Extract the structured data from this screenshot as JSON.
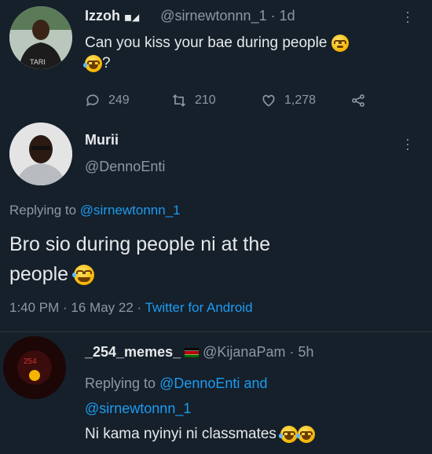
{
  "tweet1": {
    "name": "Izzoh",
    "handle": "@sirnewtonnn_1",
    "time": "· 1d",
    "text_line1": "Can you kiss your bae during people",
    "text_line2": "?",
    "replies": "249",
    "retweets": "210",
    "likes": "1,278"
  },
  "tweet2": {
    "name": "Murii",
    "handle": "@DennoEnti",
    "replying_prefix": "Replying to",
    "replying_to": "@sirnewtonnn_1",
    "text_line1": "Bro sio during people ni at the",
    "text_line2": "people",
    "timestamp": "1:40 PM · 16 May 22 ·",
    "source": "Twitter for Android"
  },
  "tweet3": {
    "name": "_254_memes_",
    "handle": "@KijanaPam",
    "time": "· 5h",
    "replying_prefix": "Replying to",
    "replying_to_1": "@DennoEnti",
    "replying_and": "and",
    "replying_to_2": "@sirnewtonnn_1",
    "text": "Ni kama nyinyi ni classmates"
  },
  "icons": [
    "reply-icon",
    "retweet-icon",
    "like-icon",
    "share-icon",
    "more-icon",
    "kenya-flag-icon",
    "laughing-emoji-icon",
    "thinking-emoji-icon"
  ]
}
